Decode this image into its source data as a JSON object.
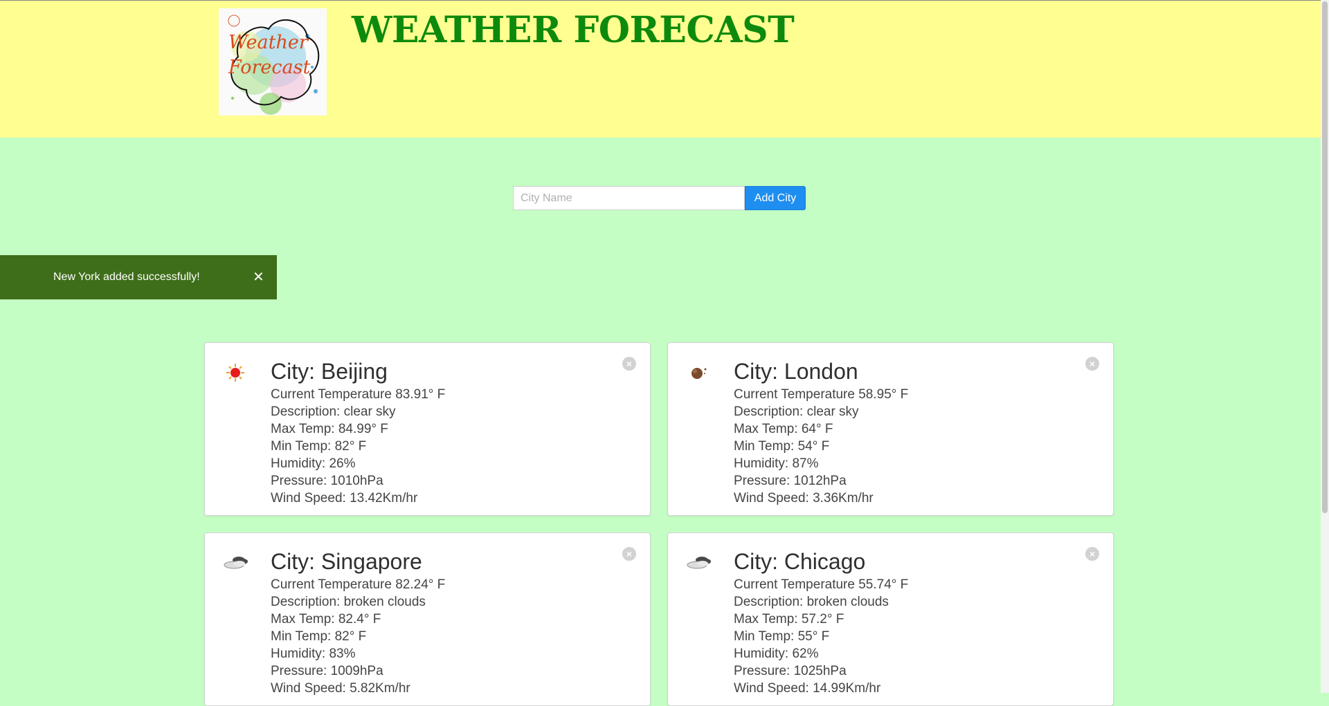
{
  "header": {
    "title": "WEATHER FORECAST",
    "logo_text_line1": "Weather",
    "logo_text_line2": "Forecast"
  },
  "form": {
    "city_placeholder": "City Name",
    "city_value": "",
    "add_button_label": "Add City"
  },
  "toast": {
    "message": "New York added successfully!",
    "close_glyph": "✕"
  },
  "cards": [
    {
      "city": "City: Beijing",
      "icon": "sun-icon",
      "temp": "Current Temperature 83.91° F",
      "description": "Description: clear sky",
      "max_temp": "Max Temp: 84.99° F",
      "min_temp": "Min Temp: 82° F",
      "humidity": "Humidity: 26%",
      "pressure": "Pressure: 1010hPa",
      "wind": "Wind Speed: 13.42Km/hr"
    },
    {
      "city": "City: London",
      "icon": "moon-icon",
      "temp": "Current Temperature 58.95° F",
      "description": "Description: clear sky",
      "max_temp": "Max Temp: 64° F",
      "min_temp": "Min Temp: 54° F",
      "humidity": "Humidity: 87%",
      "pressure": "Pressure: 1012hPa",
      "wind": "Wind Speed: 3.36Km/hr"
    },
    {
      "city": "City: Singapore",
      "icon": "broken-clouds-icon",
      "temp": "Current Temperature 82.24° F",
      "description": "Description: broken clouds",
      "max_temp": "Max Temp: 82.4° F",
      "min_temp": "Min Temp: 82° F",
      "humidity": "Humidity: 83%",
      "pressure": "Pressure: 1009hPa",
      "wind": "Wind Speed: 5.82Km/hr"
    },
    {
      "city": "City: Chicago",
      "icon": "broken-clouds-icon",
      "temp": "Current Temperature 55.74° F",
      "description": "Description: broken clouds",
      "max_temp": "Max Temp: 57.2° F",
      "min_temp": "Min Temp: 55° F",
      "humidity": "Humidity: 62%",
      "pressure": "Pressure: 1025hPa",
      "wind": "Wind Speed: 14.99Km/hr"
    }
  ],
  "colors": {
    "header_bg": "#fffe90",
    "page_bg": "#c4fec4",
    "title": "#0d8a0d",
    "button": "#1e8ef0",
    "toast_bg": "#3f6e1a"
  }
}
